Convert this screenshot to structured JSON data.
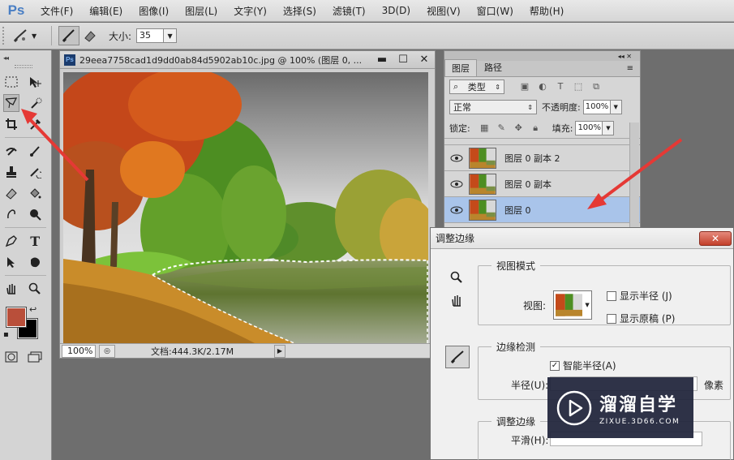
{
  "app": {
    "logo": "Ps"
  },
  "menu": {
    "items": [
      "文件(F)",
      "编辑(E)",
      "图像(I)",
      "图层(L)",
      "文字(Y)",
      "选择(S)",
      "滤镜(T)",
      "3D(D)",
      "视图(V)",
      "窗口(W)",
      "帮助(H)"
    ]
  },
  "options_bar": {
    "size_label": "大小:",
    "size_value": "35",
    "active_tool_icon": "refine-radius-brush-icon"
  },
  "foreground_color": "#b94f3a",
  "background_color": "#000000",
  "document": {
    "title": "29eea7758cad1d9dd0ab84d5902ab10c.jpg @ 100% (图层 0, ...",
    "zoom": "100%",
    "doc_info": "文档:444.3K/2.17M"
  },
  "layers_panel": {
    "tabs": [
      "图层",
      "路径"
    ],
    "filter_type": "类型",
    "blend_mode": "正常",
    "opacity_label": "不透明度:",
    "opacity_value": "100%",
    "lock_label": "锁定:",
    "fill_label": "填充:",
    "fill_value": "100%",
    "layers": [
      {
        "name": "图层 0 副本 2",
        "visible": true,
        "selected": false
      },
      {
        "name": "图层 0 副本",
        "visible": true,
        "selected": false
      },
      {
        "name": "图层 0",
        "visible": true,
        "selected": true
      }
    ]
  },
  "refine_edge_dialog": {
    "title": "调整边缘",
    "view_mode": {
      "legend": "视图模式",
      "view_label": "视图:",
      "show_radius": "显示半径 (J)",
      "show_radius_checked": false,
      "show_original": "显示原稿 (P)",
      "show_original_checked": false
    },
    "edge_detection": {
      "legend": "边缘检测",
      "smart_radius": "智能半径(A)",
      "smart_radius_checked": true,
      "radius_label": "半径(U):",
      "radius_unit": "像素"
    },
    "adjust_edge": {
      "legend": "调整边缘",
      "smooth_label": "平滑(H):"
    }
  },
  "watermark": {
    "brand": "溜溜自学",
    "url": "ZIXUE.3D66.COM"
  }
}
